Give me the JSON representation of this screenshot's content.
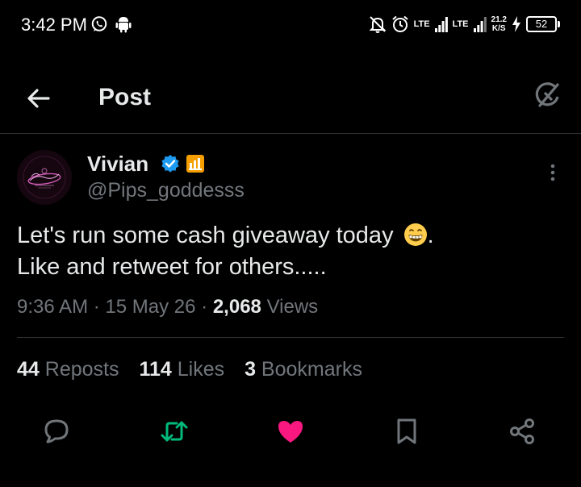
{
  "status_bar": {
    "time": "3:42 PM",
    "network_1": "LTE",
    "network_2": "LTE",
    "speed_value": "21.2",
    "speed_unit": "K/S",
    "battery": "52",
    "icons": [
      "whatsapp-icon",
      "android-icon",
      "do-not-disturb-icon",
      "alarm-icon",
      "signal-icon",
      "signal-icon",
      "charging-icon",
      "battery-icon"
    ]
  },
  "header": {
    "title": "Post",
    "icons": [
      "back-arrow-icon",
      "grok-icon"
    ]
  },
  "post": {
    "author_name": "Vivian",
    "handle": "@Pips_goddesss",
    "text_line_1": "Let's run some cash giveaway today",
    "text_line_1_end": ".",
    "text_line_2": "Like and retweet for others.....",
    "emoji": "grinning-face-icon",
    "time": "9:36 AM",
    "separator": "·",
    "date": "15 May 26",
    "views_count": "2,068",
    "views_label": "Views",
    "badges": [
      "verified-badge-icon",
      "affiliate-badge-icon"
    ]
  },
  "stats": {
    "reposts_count": "44",
    "reposts_label": "Reposts",
    "likes_count": "114",
    "likes_label": "Likes",
    "bookmarks_count": "3",
    "bookmarks_label": "Bookmarks"
  },
  "actions": {
    "icons": [
      "reply-icon",
      "repost-icon",
      "like-icon",
      "bookmark-icon",
      "share-icon"
    ],
    "repost_color": "#00ba7c",
    "like_color": "#f91880"
  },
  "colors": {
    "background": "#000000",
    "text": "#e7e9ea",
    "secondary_text": "#71767b",
    "verified_blue": "#1d9bf0",
    "affiliate_orange": "#f59f00"
  }
}
